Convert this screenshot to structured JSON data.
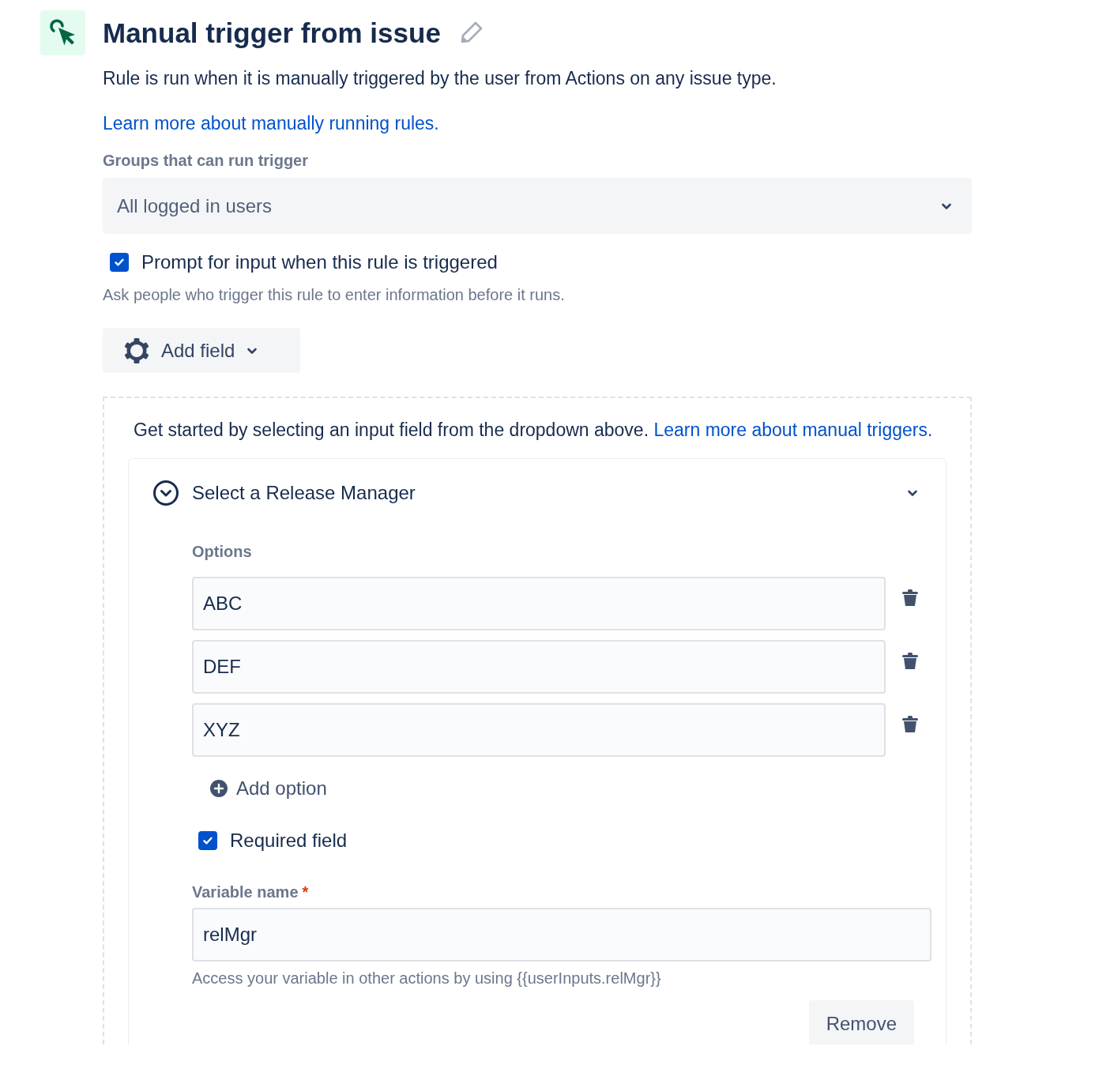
{
  "header": {
    "title": "Manual trigger from issue"
  },
  "description": "Rule is run when it is manually triggered by the user from Actions on any issue type.",
  "learn_link": "Learn more about manually running rules.",
  "groups": {
    "label": "Groups that can run trigger",
    "value": "All logged in users"
  },
  "prompt": {
    "label": "Prompt for input when this rule is triggered",
    "checked": true,
    "hint": "Ask people who trigger this rule to enter information before it runs."
  },
  "add_field_button": "Add field",
  "inputs_panel": {
    "intro": "Get started by selecting an input field from the dropdown above.",
    "intro_link": "Learn more about manual triggers.",
    "field": {
      "title": "Select a Release Manager",
      "options_label": "Options",
      "options": [
        "ABC",
        "DEF",
        "XYZ"
      ],
      "add_option": "Add option",
      "required": {
        "label": "Required field",
        "checked": true
      },
      "variable": {
        "label": "Variable name",
        "required_mark": "*",
        "value": "relMgr",
        "hint": "Access your variable in other actions by using {{userInputs.relMgr}}"
      },
      "remove_button": "Remove"
    }
  }
}
